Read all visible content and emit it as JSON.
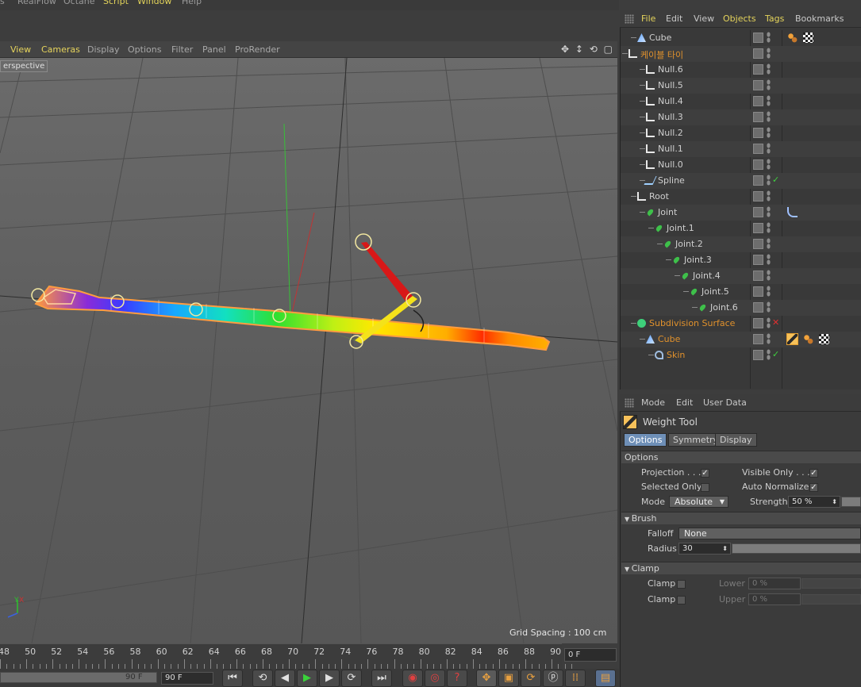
{
  "top_menu": {
    "items": [
      {
        "label": "s",
        "hi": false
      },
      {
        "label": "RealFlow",
        "hi": false
      },
      {
        "label": "Octane",
        "hi": false
      },
      {
        "label": "Script",
        "hi": true
      },
      {
        "label": "Window",
        "hi": true
      },
      {
        "label": "Help",
        "hi": false
      }
    ]
  },
  "viewport": {
    "menu": [
      {
        "label": "View",
        "hi": true
      },
      {
        "label": "Cameras",
        "hi": true
      },
      {
        "label": "Display",
        "hi": false
      },
      {
        "label": "Options",
        "hi": false
      },
      {
        "label": "Filter",
        "hi": false
      },
      {
        "label": "Panel",
        "hi": false
      },
      {
        "label": "ProRender",
        "hi": false
      }
    ],
    "camera_label": "erspective",
    "grid_spacing": "Grid Spacing : 100 cm",
    "axis_y": "Y",
    "axis_x": "X",
    "nav_icons": "✥ ↕ ⟲ ▢"
  },
  "timeline": {
    "ticks": [
      "48",
      "50",
      "52",
      "54",
      "56",
      "58",
      "60",
      "62",
      "64",
      "66",
      "68",
      "70",
      "72",
      "74",
      "76",
      "78",
      "80",
      "82",
      "84",
      "86",
      "88",
      "90"
    ],
    "current_frame": "0 F",
    "range_end_slider": "90 F",
    "range_end_field": "90 F"
  },
  "playback": {
    "buttons": [
      "⏮",
      "⟲",
      "◀",
      "▶",
      "▶",
      "⟳",
      "⏭"
    ]
  },
  "object_manager": {
    "menu": [
      {
        "label": "File",
        "hi": true
      },
      {
        "label": "Edit",
        "hi": false
      },
      {
        "label": "View",
        "hi": false
      },
      {
        "label": "Objects",
        "hi": true
      },
      {
        "label": "Tags",
        "hi": true
      },
      {
        "label": "Bookmarks",
        "hi": false
      }
    ],
    "rows": [
      {
        "name": "Cube",
        "indent": 1,
        "icon": "cube-icon",
        "color": "normal",
        "tags": [
          "material-dots",
          "checker"
        ],
        "check": ""
      },
      {
        "name": "케이블 타이",
        "indent": 0,
        "icon": "null-icon",
        "color": "orange",
        "tags": [],
        "check": ""
      },
      {
        "name": "Null.6",
        "indent": 2,
        "icon": "null-icon",
        "color": "normal",
        "tags": [],
        "check": ""
      },
      {
        "name": "Null.5",
        "indent": 2,
        "icon": "null-icon",
        "color": "normal",
        "tags": [],
        "check": ""
      },
      {
        "name": "Null.4",
        "indent": 2,
        "icon": "null-icon",
        "color": "normal",
        "tags": [],
        "check": ""
      },
      {
        "name": "Null.3",
        "indent": 2,
        "icon": "null-icon",
        "color": "normal",
        "tags": [],
        "check": ""
      },
      {
        "name": "Null.2",
        "indent": 2,
        "icon": "null-icon",
        "color": "normal",
        "tags": [],
        "check": ""
      },
      {
        "name": "Null.1",
        "indent": 2,
        "icon": "null-icon",
        "color": "normal",
        "tags": [],
        "check": ""
      },
      {
        "name": "Null.0",
        "indent": 2,
        "icon": "null-icon",
        "color": "normal",
        "tags": [],
        "check": ""
      },
      {
        "name": "Spline",
        "indent": 2,
        "icon": "spline-icon",
        "color": "normal",
        "tags": [],
        "check": "✓"
      },
      {
        "name": "Root",
        "indent": 1,
        "icon": "null-icon",
        "color": "normal",
        "tags": [],
        "check": ""
      },
      {
        "name": "Joint",
        "indent": 2,
        "icon": "joint-icon",
        "color": "normal",
        "tags": [
          "ik"
        ],
        "check": ""
      },
      {
        "name": "Joint.1",
        "indent": 3,
        "icon": "joint-icon",
        "color": "normal",
        "tags": [],
        "check": ""
      },
      {
        "name": "Joint.2",
        "indent": 4,
        "icon": "joint-icon",
        "color": "normal",
        "tags": [],
        "check": ""
      },
      {
        "name": "Joint.3",
        "indent": 5,
        "icon": "joint-icon",
        "color": "normal",
        "tags": [],
        "check": ""
      },
      {
        "name": "Joint.4",
        "indent": 6,
        "icon": "joint-icon",
        "color": "normal",
        "tags": [],
        "check": ""
      },
      {
        "name": "Joint.5",
        "indent": 7,
        "icon": "joint-icon",
        "color": "normal",
        "tags": [],
        "check": ""
      },
      {
        "name": "Joint.6",
        "indent": 8,
        "icon": "joint-icon",
        "color": "normal",
        "tags": [],
        "check": ""
      },
      {
        "name": "Subdivision Surface",
        "indent": 1,
        "icon": "subdiv-icon",
        "color": "orange",
        "tags": [],
        "check": "✕"
      },
      {
        "name": "Cube",
        "indent": 2,
        "icon": "cube-icon",
        "color": "orange",
        "tags": [
          "weight",
          "material-dots",
          "checker"
        ],
        "check": ""
      },
      {
        "name": "Skin",
        "indent": 3,
        "icon": "skin-icon",
        "color": "orange",
        "tags": [],
        "check": "✓"
      }
    ]
  },
  "attribute_manager": {
    "menu": [
      "Mode",
      "Edit",
      "User Data"
    ],
    "tool_title": "Weight Tool",
    "tabs": [
      {
        "label": "Options",
        "on": true
      },
      {
        "label": "Symmetry",
        "on": false
      },
      {
        "label": "Display",
        "on": false
      }
    ],
    "options_header": "Options",
    "projection_label": "Projection . . .",
    "projection_checked": "✓",
    "visible_only_label": "Visible Only . . .",
    "visible_only_checked": "✓",
    "selected_only_label": "Selected Only",
    "auto_normalize_label": "Auto Normalize",
    "auto_normalize_checked": "✓",
    "mode_label": "Mode",
    "mode_value": "Absolute",
    "strength_label": "Strength",
    "strength_value": "50 %",
    "brush_header": "Brush",
    "falloff_label": "Falloff",
    "falloff_value": "None",
    "radius_label": "Radius",
    "radius_value": "30",
    "clamp_header": "Clamp",
    "clamp1_label": "Clamp",
    "lower_label": "Lower",
    "lower_value": "0 %",
    "clamp2_label": "Clamp",
    "upper_label": "Upper",
    "upper_value": "0 %"
  },
  "colors": {
    "accent_yellow": "#e2d35a",
    "orange": "#e0912c",
    "tab_active": "#6e8fb7"
  }
}
